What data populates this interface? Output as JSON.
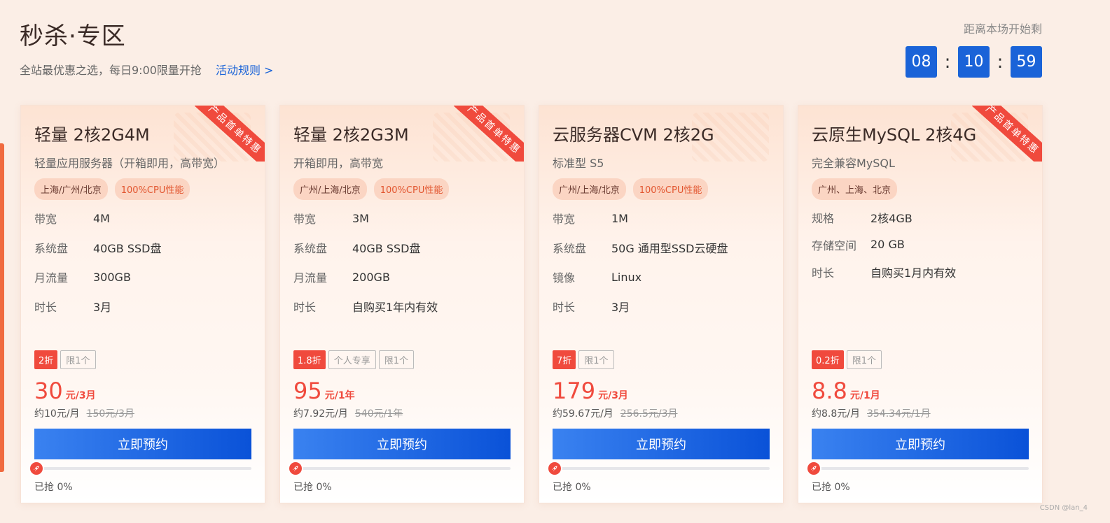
{
  "header": {
    "title": "秒杀·专区",
    "subtitle": "全站最优惠之选，每日9:00限量开抢",
    "rules_link": "活动规则 >"
  },
  "countdown": {
    "label": "距离本场开始剩",
    "hours": "08",
    "minutes": "10",
    "seconds": "59",
    "separator": ":"
  },
  "colors": {
    "accent_red": "#f04a3d",
    "accent_blue": "#1a63d8",
    "page_bg": "#fbeee6"
  },
  "cards": [
    {
      "ribbon": "产品首单特惠",
      "title": "轻量 2核2G4M",
      "subtitle": "轻量应用服务器（开箱即用，高带宽）",
      "tags": [
        "上海/广州/北京",
        "100%CPU性能"
      ],
      "specs": [
        {
          "key": "带宽",
          "value": "4M"
        },
        {
          "key": "系统盘",
          "value": "40GB SSD盘"
        },
        {
          "key": "月流量",
          "value": "300GB"
        },
        {
          "key": "时长",
          "value": "3月"
        }
      ],
      "badges": {
        "discount": "2折",
        "extra": "",
        "limit": "限1个"
      },
      "price": "30",
      "price_unit": "元/3月",
      "monthly": "约10元/月",
      "original": "150元/3月",
      "button": "立即预约",
      "sold_label": "已抢 0%",
      "sold_fraction": 0
    },
    {
      "ribbon": "产品首单特惠",
      "title": "轻量 2核2G3M",
      "subtitle": "开箱即用，高带宽",
      "tags": [
        "广州/上海/北京",
        "100%CPU性能"
      ],
      "specs": [
        {
          "key": "带宽",
          "value": "3M"
        },
        {
          "key": "系统盘",
          "value": "40GB SSD盘"
        },
        {
          "key": "月流量",
          "value": "200GB"
        },
        {
          "key": "时长",
          "value": "自购买1年内有效"
        }
      ],
      "badges": {
        "discount": "1.8折",
        "extra": "个人专享",
        "limit": "限1个"
      },
      "price": "95",
      "price_unit": "元/1年",
      "monthly": "约7.92元/月",
      "original": "540元/1年",
      "button": "立即预约",
      "sold_label": "已抢 0%",
      "sold_fraction": 0
    },
    {
      "ribbon": "",
      "title": "云服务器CVM 2核2G",
      "subtitle": "标准型 S5",
      "tags": [
        "广州/上海/北京",
        "100%CPU性能"
      ],
      "specs": [
        {
          "key": "带宽",
          "value": "1M"
        },
        {
          "key": "系统盘",
          "value": "50G 通用型SSD云硬盘"
        },
        {
          "key": "镜像",
          "value": "Linux"
        },
        {
          "key": "时长",
          "value": "3月"
        }
      ],
      "badges": {
        "discount": "7折",
        "extra": "",
        "limit": "限1个"
      },
      "price": "179",
      "price_unit": "元/3月",
      "monthly": "约59.67元/月",
      "original": "256.5元/3月",
      "button": "立即预约",
      "sold_label": "已抢 0%",
      "sold_fraction": 0
    },
    {
      "ribbon": "产品首单特惠",
      "title": "云原生MySQL 2核4G",
      "subtitle": "完全兼容MySQL",
      "tags": [
        "广州、上海、北京"
      ],
      "specs": [
        {
          "key": "规格",
          "value": "2核4GB"
        },
        {
          "key": "存储空间",
          "value": "20 GB"
        },
        {
          "key": "时长",
          "value": "自购买1月内有效"
        }
      ],
      "badges": {
        "discount": "0.2折",
        "extra": "",
        "limit": "限1个"
      },
      "price": "8.8",
      "price_unit": "元/1月",
      "monthly": "约8.8元/月",
      "original": "354.34元/1月",
      "button": "立即预约",
      "sold_label": "已抢 0%",
      "sold_fraction": 0
    }
  ],
  "watermark": "CSDN @lan_4"
}
